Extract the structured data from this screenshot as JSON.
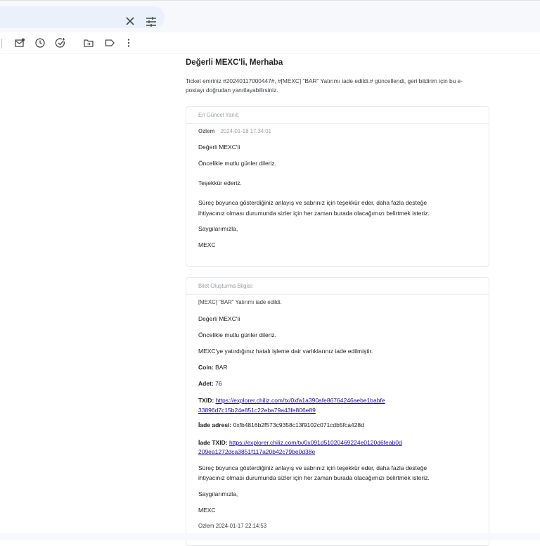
{
  "greeting": "Değerli MEXC'li, Merhaba",
  "intro_line1": "Ticket emriniz #20240117000447#, #[MEXC] \"BAR\" Yatırımı iade edildi.# güncellendi, geri bildirim için bu e-",
  "intro_line2": "postayı doğrudan yanıtlayabilirsiniz.",
  "latest": {
    "header": "En Güncel Yanıt:",
    "author": "Ozlem",
    "timestamp": "2024-01-18 17:34:01",
    "lines": [
      "Değerli MEXC'li",
      "Öncelikle mutlu günler dileriz.",
      "Teşekkür ederiz.",
      "Süreç boyunca gösterdiğiniz anlayış ve sabrınız için teşekkür eder, daha fazla desteğe",
      "ihtiyacınız olması durumunda sizler için her zaman burada olacağımızı belirtmek isteriz.",
      "Saygılarımızla,",
      "MEXC"
    ]
  },
  "ticket": {
    "header": "Bilet Oluşturma Bilgisi:",
    "subject": "[MEXC] \"BAR\" Yatırımı iade edildi.",
    "salutation": "Değerli MEXC'li",
    "wishes": "Öncelikle mutlu günler dileriz.",
    "refund_note": "MEXC'ye yatırdığınız hatalı işleme dair varlıklarınız iade edilmiştir.",
    "coin_label": "Coin:",
    "coin_value": "BAR",
    "amount_label": "Adet:",
    "amount_value": "76",
    "txid_label": "TXID:",
    "txid_line1": "https://explorer.chiliz.com/tx/0xfa1a390afe86764246aebe1babfe",
    "txid_line2": "33896d7c15b24e851c22eba79a43fe806e89",
    "refund_address_label": "İade adresi:",
    "refund_address_value": "0xfb4816b2f573c9358c13f9102c071cdb5fca428d",
    "refund_txid_label": "İade TXID:",
    "refund_txid_line1": "https://explorer.chiliz.com/tx/0x091d51020469224e0120d6feab0d",
    "refund_txid_line2": "209ea1272dca3851f117a20b42c79be0d38e",
    "thanks_line1": "Süreç boyunca gösterdiğiniz anlayış ve sabrınız için teşekkür eder, daha fazla desteğe",
    "thanks_line2": "ihtiyacınız olması durumunda sizler için her zaman burada olacağımızı belirtmek isteriz.",
    "regards": "Saygılarımızla,",
    "signature": "MEXC",
    "footer_author": "Ozlem",
    "footer_timestamp": "2024-01-17 22:14:53"
  },
  "icons": {
    "search_close": "close-icon",
    "search_options": "tune-icon",
    "toolbar": [
      "mark-unread-icon",
      "snooze-icon",
      "add-task-icon",
      "move-to-icon",
      "label-icon",
      "more-vert-icon"
    ]
  },
  "colors": {
    "link": "#1a0dab",
    "topbar": "#f6f8fc",
    "search": "#eaf1fb"
  }
}
